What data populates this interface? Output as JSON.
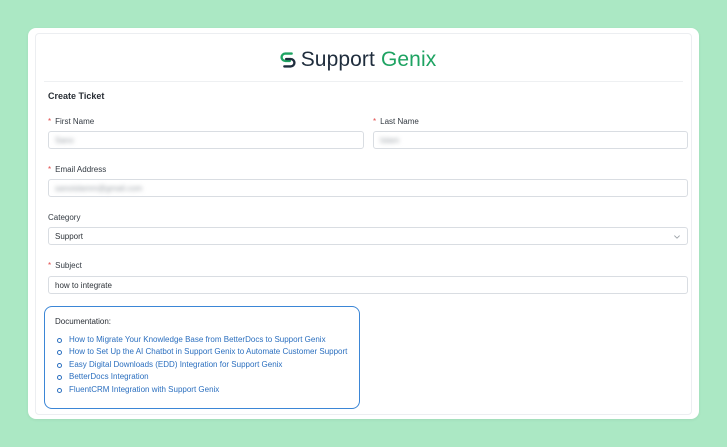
{
  "brand": {
    "name_part1": "Support",
    "name_part2": "Genix",
    "color_dark": "#1f2d3d",
    "color_green": "#1ea362"
  },
  "form": {
    "title": "Create Ticket",
    "required_marker": "*",
    "first_name": {
      "label": "First Name",
      "value": "Sano"
    },
    "last_name": {
      "label": "Last Name",
      "value": "Islam"
    },
    "email": {
      "label": "Email Address",
      "value": "sanoislamm@gmail.com"
    },
    "category": {
      "label": "Category",
      "value": "Support"
    },
    "subject": {
      "label": "Subject",
      "value": "how to integrate"
    }
  },
  "documentation": {
    "title": "Documentation:",
    "border_color": "#3b86d6",
    "links": [
      "How to Migrate Your Knowledge Base from BetterDocs to Support Genix",
      "How to Set Up the AI Chatbot in Support Genix to Automate Customer Support",
      "Easy Digital Downloads (EDD) Integration for Support Genix",
      "BetterDocs Integration",
      "FluentCRM Integration with Support Genix"
    ]
  },
  "icons": {
    "logo": "support-genix-logo-icon",
    "select_arrow": "chevron-down-icon"
  }
}
